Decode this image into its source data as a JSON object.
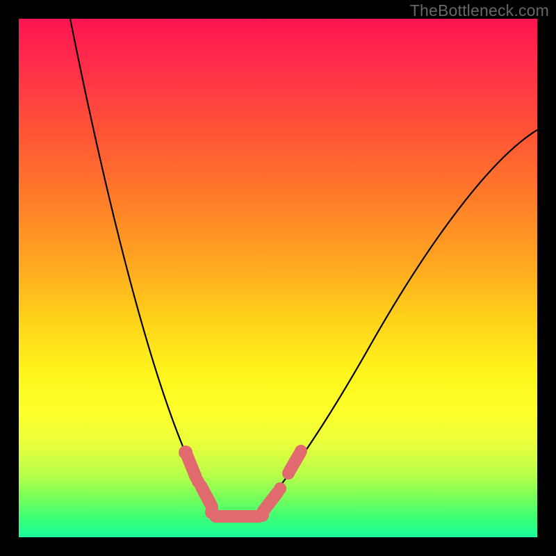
{
  "watermark": "TheBottleneck.com",
  "colors": {
    "frame_border": "#000000",
    "curve": "#000000",
    "bumps": "#e06a6d",
    "watermark_text": "#676767",
    "gradient_stops": [
      "#ff1450",
      "#ff2b4b",
      "#ff5436",
      "#ff7a2a",
      "#ffa321",
      "#ffd21a",
      "#fff41c",
      "#fdff2b",
      "#e9ff3d",
      "#b8ff4a",
      "#7dff58",
      "#3fff74",
      "#18ff9b"
    ]
  },
  "chart_data": {
    "type": "line",
    "title": "",
    "xlabel": "",
    "ylabel": "",
    "xlim": [
      0,
      100
    ],
    "ylim": [
      0,
      100
    ],
    "grid": false,
    "legend": null,
    "series": [
      {
        "name": "bottleneck-curve",
        "x": [
          10,
          15,
          20,
          25,
          30,
          35,
          38,
          40,
          44,
          48,
          55,
          65,
          75,
          85,
          95,
          100
        ],
        "values": [
          100,
          79,
          58,
          40,
          25,
          12,
          5,
          3,
          3,
          6,
          15,
          32,
          50,
          65,
          76,
          79
        ]
      }
    ],
    "annotations": [
      {
        "name": "highlighted-trough-range-left-descent",
        "x_range": [
          32,
          38
        ],
        "y_range": [
          4,
          16
        ]
      },
      {
        "name": "highlighted-trough-flat",
        "x_range": [
          38,
          47
        ],
        "y_range": [
          3,
          4
        ]
      },
      {
        "name": "highlighted-trough-right-ascent-lower",
        "x_range": [
          47,
          51
        ],
        "y_range": [
          4,
          10
        ]
      },
      {
        "name": "highlighted-trough-right-ascent-upper",
        "x_range": [
          52,
          55
        ],
        "y_range": [
          13,
          17
        ]
      }
    ],
    "background": "vertical-gradient red→orange→yellow→green"
  }
}
